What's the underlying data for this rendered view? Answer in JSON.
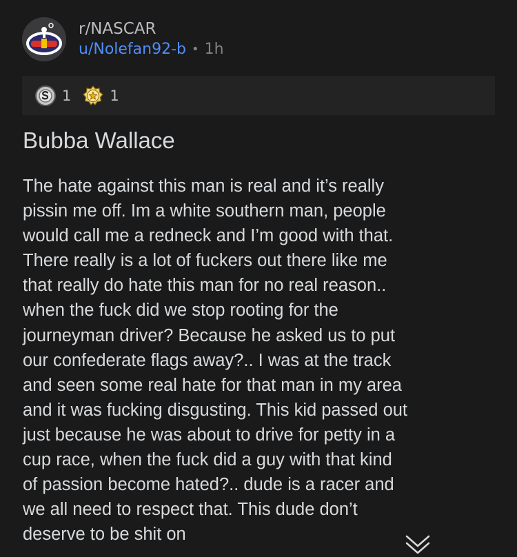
{
  "post": {
    "subreddit": "r/NASCAR",
    "author": "u/Nolefan92-b",
    "separator": "•",
    "age": "1h",
    "awards": [
      {
        "icon": "silver-award-icon",
        "count": "1"
      },
      {
        "icon": "helpful-award-icon",
        "count": "1"
      }
    ],
    "title": "Bubba Wallace",
    "body_lines": [
      "The hate against this man is real and it’s really",
      "pissin me off. Im a white southern man, people",
      "would call me a redneck and I’m good with that.",
      "There really is a lot of fuckers out there like me",
      "that really do hate this man for no real reason..",
      "when the fuck did we stop rooting for the",
      "journeyman driver? Because he asked us to put",
      "our confederate flags away?.. I was at the track",
      "and seen some real hate for that man in my area",
      "and it was fucking disgusting. This kid passed out",
      "just because he was about to drive for petty in a",
      "cup race, when the fuck did a guy with that kind",
      "of passion become hated?.. dude is a racer and",
      "we all need to respect that. This dude don’t",
      "deserve to be shit on"
    ]
  },
  "colors": {
    "background": "#1a1a1b",
    "award_bar": "#232324",
    "username": "#4f8ef7",
    "text": "#d7dadc",
    "muted": "#818384"
  }
}
